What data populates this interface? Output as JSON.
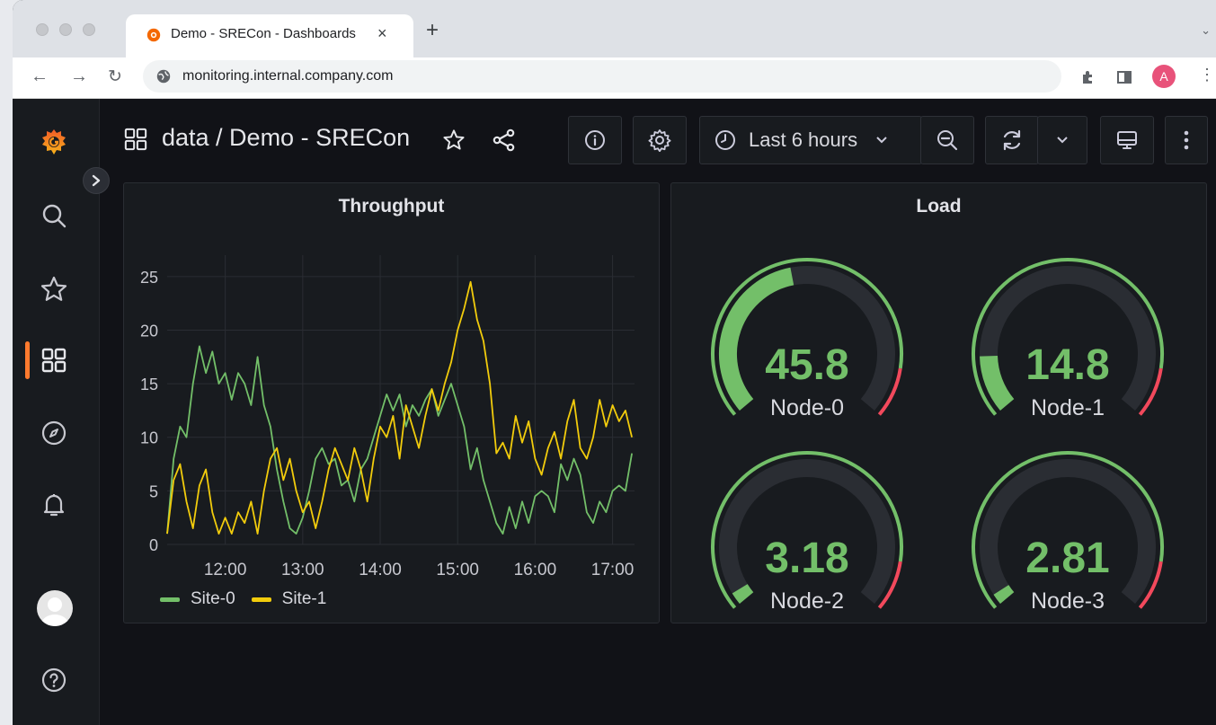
{
  "browser": {
    "tab": {
      "title": "Demo - SRECon - Dashboards",
      "close": "×"
    },
    "new_tab": "+",
    "url": "monitoring.internal.company.com",
    "profile_initial": "A"
  },
  "dashboard": {
    "breadcrumb": "data  / Demo - SRECon",
    "time_range": "Last 6 hours"
  },
  "panels": {
    "throughput": {
      "title": "Throughput"
    },
    "load": {
      "title": "Load"
    }
  },
  "chart_data": {
    "type": "line",
    "title": "Throughput",
    "y_ticks": [
      "0",
      "5",
      "10",
      "15",
      "20",
      "25"
    ],
    "x_ticks": [
      "12:00",
      "13:00",
      "14:00",
      "15:00",
      "16:00",
      "17:00"
    ],
    "ylim": [
      0,
      27
    ],
    "xlim": [
      "11:15",
      "17:17"
    ],
    "grid": true,
    "legend": "bottom-left",
    "series": [
      {
        "name": "Site-0",
        "color": "#73bf69",
        "points": [
          [
            "11:15",
            1
          ],
          [
            "11:20",
            8
          ],
          [
            "11:25",
            11
          ],
          [
            "11:30",
            10
          ],
          [
            "11:35",
            15
          ],
          [
            "11:40",
            18.5
          ],
          [
            "11:45",
            16
          ],
          [
            "11:50",
            18
          ],
          [
            "11:55",
            15
          ],
          [
            "12:00",
            16
          ],
          [
            "12:05",
            13.5
          ],
          [
            "12:10",
            16
          ],
          [
            "12:15",
            15
          ],
          [
            "12:20",
            13
          ],
          [
            "12:25",
            17.5
          ],
          [
            "12:30",
            13
          ],
          [
            "12:35",
            11
          ],
          [
            "12:40",
            7
          ],
          [
            "12:45",
            4
          ],
          [
            "12:50",
            1.5
          ],
          [
            "12:55",
            1
          ],
          [
            "13:00",
            2.5
          ],
          [
            "13:05",
            5
          ],
          [
            "13:10",
            8
          ],
          [
            "13:15",
            9
          ],
          [
            "13:20",
            7.5
          ],
          [
            "13:25",
            8
          ],
          [
            "13:30",
            5.5
          ],
          [
            "13:35",
            6
          ],
          [
            "13:40",
            4
          ],
          [
            "13:45",
            7
          ],
          [
            "13:50",
            8
          ],
          [
            "13:55",
            10
          ],
          [
            "14:00",
            12
          ],
          [
            "14:05",
            14
          ],
          [
            "14:10",
            12.5
          ],
          [
            "14:15",
            14
          ],
          [
            "14:20",
            11
          ],
          [
            "14:25",
            13
          ],
          [
            "14:30",
            12
          ],
          [
            "14:35",
            13.5
          ],
          [
            "14:40",
            14.5
          ],
          [
            "14:45",
            12
          ],
          [
            "14:50",
            13.5
          ],
          [
            "14:55",
            15
          ],
          [
            "15:00",
            13
          ],
          [
            "15:05",
            11
          ],
          [
            "15:10",
            7
          ],
          [
            "15:15",
            9
          ],
          [
            "15:20",
            6
          ],
          [
            "15:25",
            4
          ],
          [
            "15:30",
            2
          ],
          [
            "15:35",
            1
          ],
          [
            "15:40",
            3.5
          ],
          [
            "15:45",
            1.5
          ],
          [
            "15:50",
            4
          ],
          [
            "15:55",
            2
          ],
          [
            "16:00",
            4.5
          ],
          [
            "16:05",
            5
          ],
          [
            "16:10",
            4.5
          ],
          [
            "16:15",
            3
          ],
          [
            "16:20",
            7.5
          ],
          [
            "16:25",
            6
          ],
          [
            "16:30",
            8
          ],
          [
            "16:35",
            6.5
          ],
          [
            "16:40",
            3
          ],
          [
            "16:45",
            2
          ],
          [
            "16:50",
            4
          ],
          [
            "16:55",
            3
          ],
          [
            "17:00",
            5
          ],
          [
            "17:05",
            5.5
          ],
          [
            "17:10",
            5
          ],
          [
            "17:15",
            8.5
          ]
        ]
      },
      {
        "name": "Site-1",
        "color": "#f2cc0c",
        "points": [
          [
            "11:15",
            1
          ],
          [
            "11:20",
            6
          ],
          [
            "11:25",
            7.5
          ],
          [
            "11:30",
            4
          ],
          [
            "11:35",
            1.5
          ],
          [
            "11:40",
            5.5
          ],
          [
            "11:45",
            7
          ],
          [
            "11:50",
            3
          ],
          [
            "11:55",
            1
          ],
          [
            "12:00",
            2.5
          ],
          [
            "12:05",
            1
          ],
          [
            "12:10",
            3
          ],
          [
            "12:15",
            2
          ],
          [
            "12:20",
            4
          ],
          [
            "12:25",
            1
          ],
          [
            "12:30",
            5
          ],
          [
            "12:35",
            8
          ],
          [
            "12:40",
            9
          ],
          [
            "12:45",
            6
          ],
          [
            "12:50",
            8
          ],
          [
            "12:55",
            5
          ],
          [
            "13:00",
            3
          ],
          [
            "13:05",
            4
          ],
          [
            "13:10",
            1.5
          ],
          [
            "13:15",
            4
          ],
          [
            "13:20",
            7
          ],
          [
            "13:25",
            9
          ],
          [
            "13:30",
            7.5
          ],
          [
            "13:35",
            6
          ],
          [
            "13:40",
            9
          ],
          [
            "13:45",
            7
          ],
          [
            "13:50",
            4
          ],
          [
            "13:55",
            8
          ],
          [
            "14:00",
            11
          ],
          [
            "14:05",
            10
          ],
          [
            "14:10",
            12
          ],
          [
            "14:15",
            8
          ],
          [
            "14:20",
            13
          ],
          [
            "14:25",
            11
          ],
          [
            "14:30",
            9
          ],
          [
            "14:35",
            12
          ],
          [
            "14:40",
            14.5
          ],
          [
            "14:45",
            12.5
          ],
          [
            "14:50",
            15
          ],
          [
            "14:55",
            17
          ],
          [
            "15:00",
            20
          ],
          [
            "15:05",
            22
          ],
          [
            "15:10",
            24.5
          ],
          [
            "15:15",
            21
          ],
          [
            "15:20",
            19
          ],
          [
            "15:25",
            15
          ],
          [
            "15:30",
            8.5
          ],
          [
            "15:35",
            9.5
          ],
          [
            "15:40",
            8
          ],
          [
            "15:45",
            12
          ],
          [
            "15:50",
            9.5
          ],
          [
            "15:55",
            11.5
          ],
          [
            "16:00",
            8
          ],
          [
            "16:05",
            6.5
          ],
          [
            "16:10",
            9
          ],
          [
            "16:15",
            10.5
          ],
          [
            "16:20",
            8
          ],
          [
            "16:25",
            11.5
          ],
          [
            "16:30",
            13.5
          ],
          [
            "16:35",
            9
          ],
          [
            "16:40",
            8
          ],
          [
            "16:45",
            10
          ],
          [
            "16:50",
            13.5
          ],
          [
            "16:55",
            11
          ],
          [
            "17:00",
            13
          ],
          [
            "17:05",
            11.5
          ],
          [
            "17:10",
            12.5
          ],
          [
            "17:15",
            10
          ]
        ]
      }
    ]
  },
  "gauges": [
    {
      "label": "Node-0",
      "value": "45.8",
      "fraction": 0.458
    },
    {
      "label": "Node-1",
      "value": "14.8",
      "fraction": 0.148
    },
    {
      "label": "Node-2",
      "value": "3.18",
      "fraction": 0.0318
    },
    {
      "label": "Node-3",
      "value": "2.81",
      "fraction": 0.0281
    }
  ],
  "gauge_colors": {
    "value": "#73bf69",
    "threshold_green": "#73bf69",
    "threshold_red": "#f2495c",
    "track": "#2a2d33"
  }
}
